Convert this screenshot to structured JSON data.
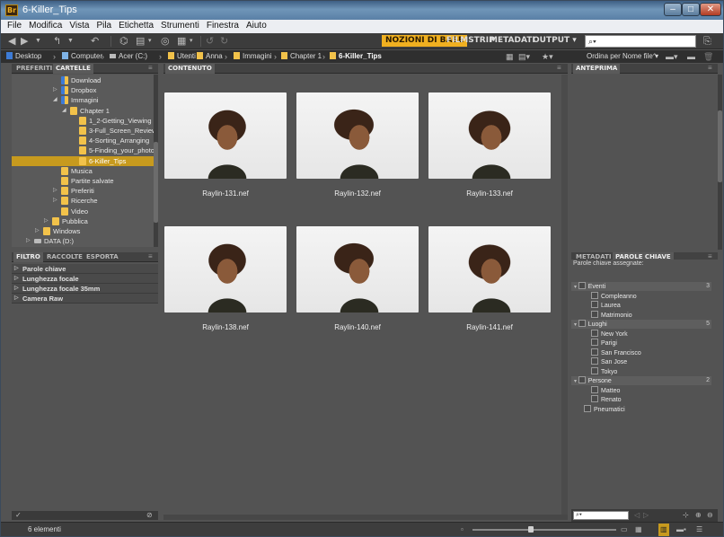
{
  "window": {
    "title": "6-Killer_Tips",
    "app_badge": "Br"
  },
  "menu": [
    "File",
    "Modifica",
    "Vista",
    "Pila",
    "Etichetta",
    "Strumenti",
    "Finestra",
    "Aiuto"
  ],
  "workspaces": [
    {
      "label": "NOZIONI DI BASE",
      "active": true
    },
    {
      "label": "FILMSTRIP",
      "active": false
    },
    {
      "label": "METADATI",
      "active": false
    },
    {
      "label": "OUTPUT ▾",
      "active": false
    }
  ],
  "search": {
    "placeholder": ""
  },
  "path": [
    {
      "label": "Desktop",
      "icon": "desktop-icon"
    },
    {
      "label": "Computer",
      "icon": "computer-icon"
    },
    {
      "label": "Acer (C:)",
      "icon": "drive-icon"
    },
    {
      "label": "Utenti",
      "icon": "folder-icon"
    },
    {
      "label": "Anna",
      "icon": "folder-icon"
    },
    {
      "label": "Immagini",
      "icon": "folder-icon"
    },
    {
      "label": "Chapter 1",
      "icon": "folder-icon"
    },
    {
      "label": "6-Killer_Tips",
      "icon": "folder-icon",
      "current": true
    }
  ],
  "left_tabs": [
    "PREFERITI",
    "CARTELLE"
  ],
  "folders": [
    {
      "label": "Download",
      "indent": 5
    },
    {
      "label": "Dropbox",
      "indent": 5,
      "tri": "▷"
    },
    {
      "label": "Immagini",
      "indent": 5,
      "tri": "◢"
    },
    {
      "label": "Chapter 1",
      "indent": 6,
      "tri": "◢"
    },
    {
      "label": "1_2-Getting_Viewing",
      "indent": 7
    },
    {
      "label": "3-Full_Screen_Review",
      "indent": 7
    },
    {
      "label": "4-Sorting_Arranging",
      "indent": 7
    },
    {
      "label": "5-Finding_your_photos",
      "indent": 7
    },
    {
      "label": "6-Killer_Tips",
      "indent": 7,
      "selected": true
    },
    {
      "label": "Musica",
      "indent": 5
    },
    {
      "label": "Partite salvate",
      "indent": 5
    },
    {
      "label": "Preferiti",
      "indent": 5,
      "tri": "▷"
    },
    {
      "label": "Ricerche",
      "indent": 5,
      "tri": "▷"
    },
    {
      "label": "Video",
      "indent": 5
    },
    {
      "label": "Pubblica",
      "indent": 4,
      "tri": "▷"
    },
    {
      "label": "Windows",
      "indent": 3,
      "tri": "▷"
    },
    {
      "label": "DATA (D:)",
      "indent": 2,
      "tri": "▷",
      "drive": true
    }
  ],
  "filter_tabs": [
    "FILTRO",
    "RACCOLTE",
    "ESPORTA"
  ],
  "filter_groups": [
    "Parole chiave",
    "Lunghezza focale",
    "Lunghezza focale 35mm",
    "Camera Raw"
  ],
  "content_tab": "CONTENUTO",
  "thumbnails": [
    "Raylin-131.nef",
    "Raylin-132.nef",
    "Raylin-133.nef",
    "Raylin-138.nef",
    "Raylin-140.nef",
    "Raylin-141.nef"
  ],
  "preview_tab": "ANTEPRIMA",
  "sort_label": "Ordina per Nome file ▾",
  "right_tabs": [
    "METADATI",
    "PAROLE CHIAVE"
  ],
  "assigned_label": "Parole chiave assegnate:",
  "keywords": [
    {
      "label": "Eventi",
      "group": true,
      "count": "3"
    },
    {
      "label": "Compleanno"
    },
    {
      "label": "Laurea"
    },
    {
      "label": "Matrimonio"
    },
    {
      "label": "Luoghi",
      "group": true,
      "count": "5"
    },
    {
      "label": "New York"
    },
    {
      "label": "Parigi"
    },
    {
      "label": "San Francisco"
    },
    {
      "label": "San Jose"
    },
    {
      "label": "Tokyo"
    },
    {
      "label": "Persone",
      "group": true,
      "count": "2"
    },
    {
      "label": "Matteo"
    },
    {
      "label": "Renato"
    },
    {
      "label": "Pneumatici",
      "top": true
    }
  ],
  "status": "6 elementi",
  "thumb_size": 0.4
}
